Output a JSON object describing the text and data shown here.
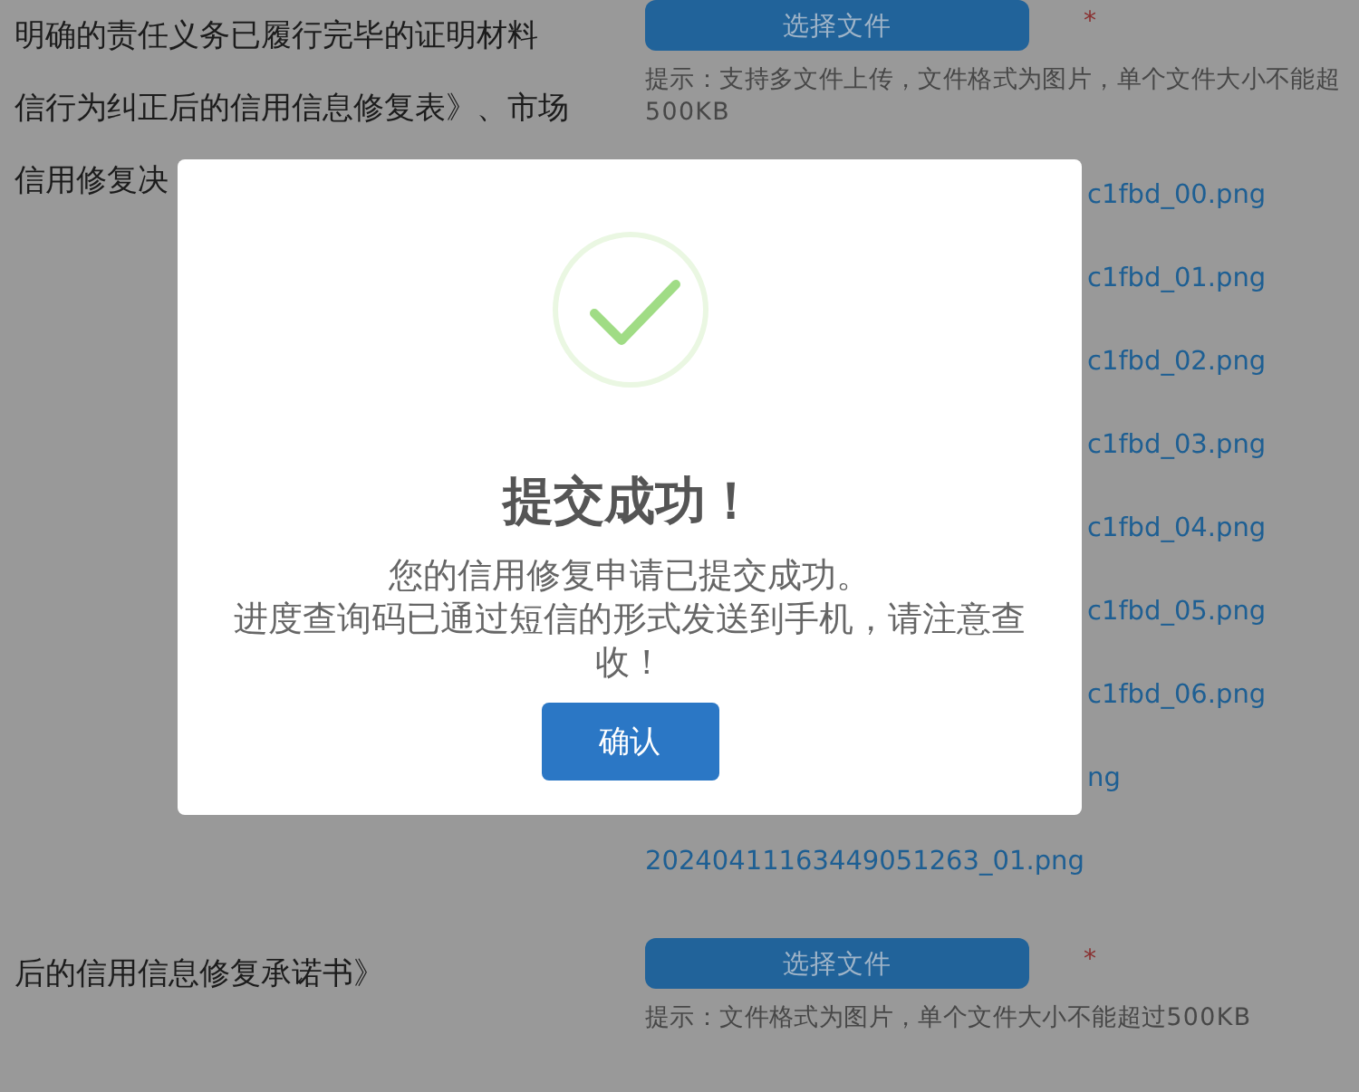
{
  "form_sections": [
    {
      "label_lines": [
        "明确的责任义务已履行完毕的证明材料",
        "信行为纠正后的信用信息修复表》、市场",
        "信用修复决"
      ],
      "upload_button": "选择文件",
      "required_mark": "*",
      "hint_lines": [
        "提示：支持多文件上传，文件格式为图片，单个文件大小不能超",
        "500KB"
      ],
      "files": [
        {
          "name": "c1fbd_00.png",
          "covered": true
        },
        {
          "name": "c1fbd_01.png",
          "covered": true
        },
        {
          "name": "c1fbd_02.png",
          "covered": true
        },
        {
          "name": "c1fbd_03.png",
          "covered": true
        },
        {
          "name": "c1fbd_04.png",
          "covered": true
        },
        {
          "name": "c1fbd_05.png",
          "covered": true
        },
        {
          "name": "c1fbd_06.png",
          "covered": true
        },
        {
          "name": "ng",
          "covered": true
        },
        {
          "name": "20240411163449051263_01.png",
          "covered": false
        }
      ]
    },
    {
      "label_lines": [
        "后的信用信息修复承诺书》"
      ],
      "upload_button": "选择文件",
      "required_mark": "*",
      "hint_lines": [
        "提示：文件格式为图片，单个文件大小不能超过500KB"
      ]
    }
  ],
  "dialog": {
    "kind": "success",
    "title": "提交成功！",
    "message_lines": [
      "您的信用修复申请已提交成功。",
      "进度查询码已通过短信的形式发送到手机，请注意查收！"
    ],
    "confirm_button": "确认"
  }
}
